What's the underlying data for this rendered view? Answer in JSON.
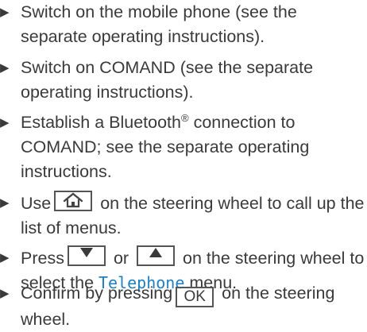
{
  "steps": [
    {
      "text_a": "Switch on the mobile phone (see the separate operating instructions)."
    },
    {
      "text_a": "Switch on COMAND (see the separate operating instructions)."
    },
    {
      "text_a": "Establish a Bluetooth",
      "reg_mark": "®",
      "text_b": " connection to COMAND; see the separate operating instructions."
    },
    {
      "text_a": "Use",
      "key_icon": "home-icon",
      "text_b": "on the steering wheel to call up the list of menus."
    },
    {
      "text_a": "Press",
      "key1_icon": "arrow-down-icon",
      "or_word": "or",
      "key2_icon": "arrow-up-icon",
      "text_b": "on the steering wheel to select the",
      "menu_name": "Telephone",
      "text_c": "menu."
    },
    {
      "text_a": "Confirm by pressing",
      "key_label": "OK",
      "text_b": "on the steering wheel."
    }
  ],
  "bullet": "▶",
  "colors": {
    "text": "#3a3a3a",
    "menu_highlight": "#1f7fbf",
    "key_border": "#555555"
  }
}
